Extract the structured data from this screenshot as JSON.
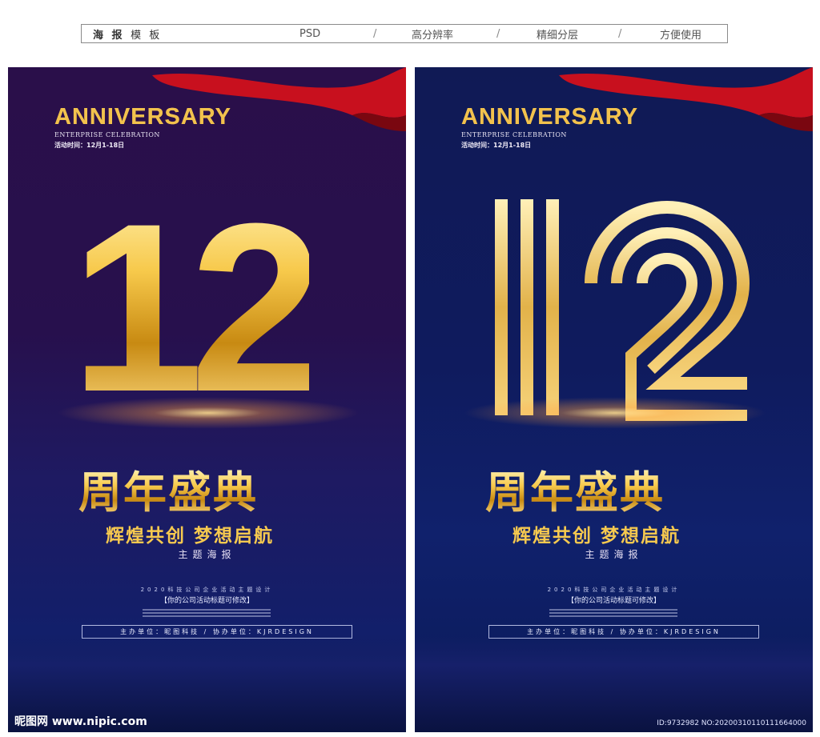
{
  "topbar": {
    "title_bold": "海 报",
    "title_light": "模 板",
    "format": "PSD",
    "resolution": "高分辨率",
    "layers": "精细分层",
    "convenience": "方便使用",
    "separator": "/"
  },
  "posters": [
    {
      "anniversary": "ANNIVERSARY",
      "enterprise": "ENTERPRISE CELEBRATION",
      "activity_time": "活动时间：12月1-18日",
      "number": "12",
      "headline": "周年盛典",
      "slogan": "辉煌共创  梦想启航",
      "theme": "主题海报",
      "subtitle": "2020科技公司企业活动主题设计",
      "company": "【你的公司活动标题可修改】",
      "organizer": "主办单位：昵图科技  /  协办单位：KJRDESIGN"
    },
    {
      "anniversary": "ANNIVERSARY",
      "enterprise": "ENTERPRISE CELEBRATION",
      "activity_time": "活动时间：12月1-18日",
      "number": "12",
      "headline": "周年盛典",
      "slogan": "辉煌共创  梦想启航",
      "theme": "主题海报",
      "subtitle": "2020科技公司企业活动主题设计",
      "company": "【你的公司活动标题可修改】",
      "organizer": "主办单位：昵图科技  /  协办单位：KJRDESIGN"
    }
  ],
  "watermark": {
    "site": "昵图网 www.nipic.com",
    "id": "ID:9732982 NO:20200310110111664000"
  },
  "colors": {
    "gold": "#f2c24d",
    "ribbon_red": "#c8101e"
  }
}
